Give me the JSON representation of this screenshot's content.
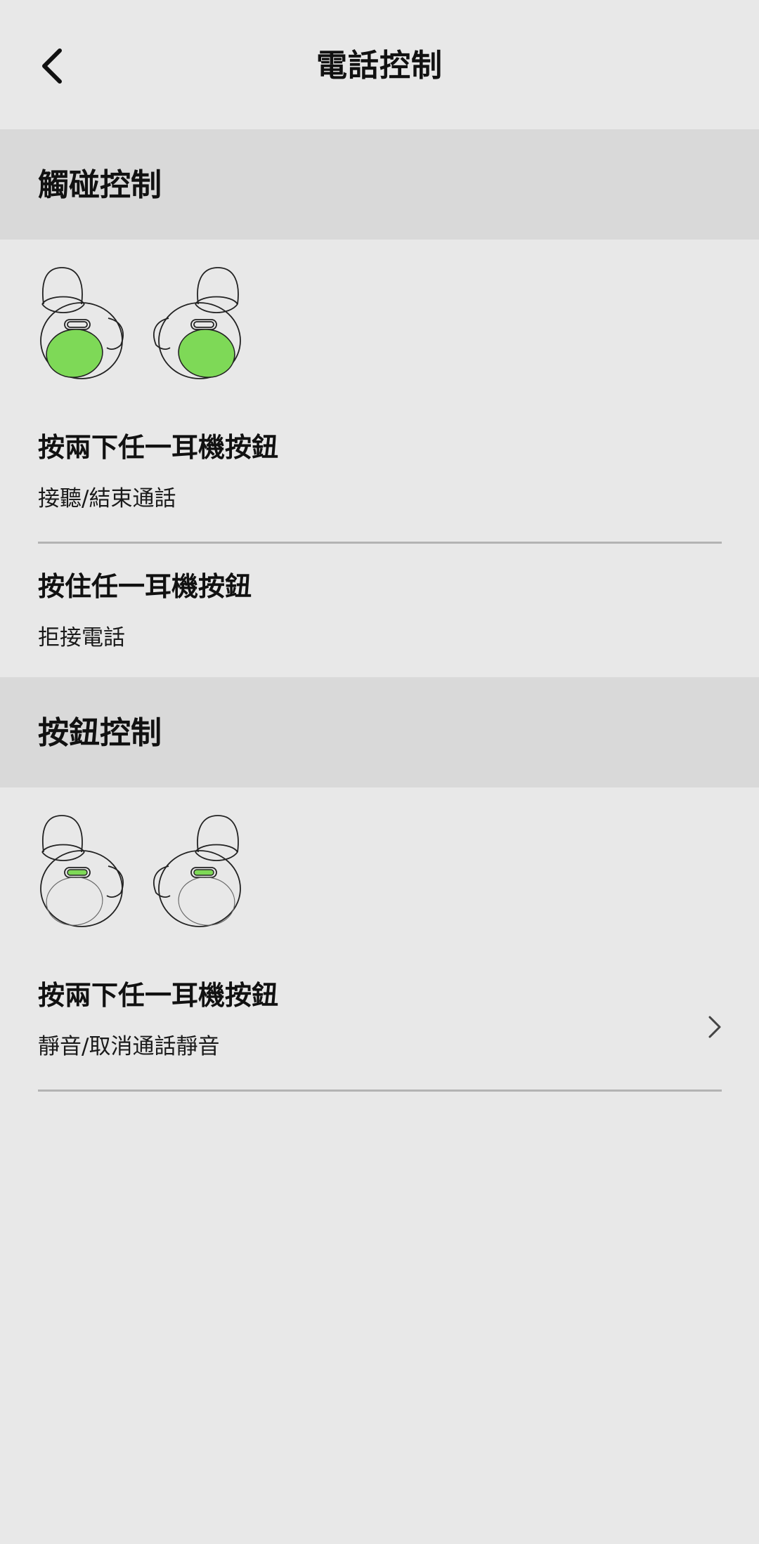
{
  "header": {
    "title": "電話控制",
    "back_icon": "chevron-left-icon"
  },
  "sections": [
    {
      "label": "觸碰控制",
      "illustration": "earbuds-touch-area-icon",
      "highlight_color": "#7ed957",
      "rows": [
        {
          "title": "按兩下任一耳機按鈕",
          "subtitle": "接聽/結束通話"
        },
        {
          "title": "按住任一耳機按鈕",
          "subtitle": "拒接電話"
        }
      ]
    },
    {
      "label": "按鈕控制",
      "illustration": "earbuds-button-icon",
      "highlight_color": "#7ed957",
      "rows": [
        {
          "title": "按兩下任一耳機按鈕",
          "subtitle": "靜音/取消通話靜音",
          "trailing_icon": "chevron-right-icon"
        }
      ]
    }
  ],
  "colors": {
    "background": "#e8e8e8",
    "section_header": "#d9d9d9",
    "divider": "#b3b3b3",
    "accent_green": "#7ed957"
  }
}
